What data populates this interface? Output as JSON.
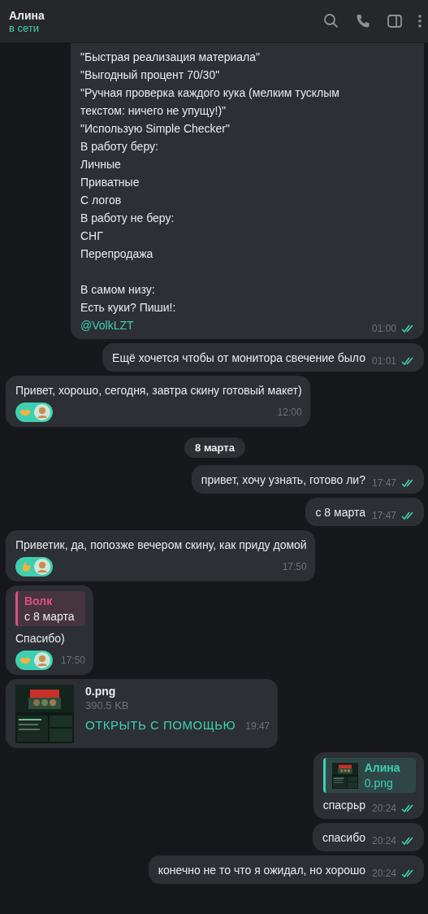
{
  "header": {
    "name": "Алина",
    "status": "в сети"
  },
  "messages": [
    {
      "kind": "text",
      "outgoing": true,
      "continued": true,
      "blocks": [
        [
          "\"Быстрая реализация материала\"",
          "\"Выгодный процент 70/30\"",
          "\"Ручная проверка каждого кука (мелким тусклым текстом: ничего не упущу!)\"",
          "\"Использую Simple Checker\"",
          "В работу беру:",
          "Личные",
          "Приватные",
          "С логов",
          "В работу не беру:",
          "СНГ",
          "Перепродажа"
        ],
        [
          "В самом низу:",
          "Есть куки? Пиши!:"
        ]
      ],
      "link": "@VolkLZT",
      "time": "01:00",
      "read": true
    },
    {
      "kind": "text",
      "outgoing": true,
      "blocks": [
        [
          "Ещё хочется чтобы от монитора свечение было"
        ]
      ],
      "time": "01:01",
      "read": true
    },
    {
      "kind": "text",
      "outgoing": false,
      "blocks": [
        [
          "Привет, хорошо, сегодня, завтра скину готовый макет)"
        ]
      ],
      "reactions": [
        {
          "kind": "handshake"
        },
        {
          "kind": "avatar"
        }
      ],
      "time": "12:00"
    },
    {
      "kind": "date",
      "text": "8 марта"
    },
    {
      "kind": "text",
      "outgoing": true,
      "blocks": [
        [
          "привет, хочу узнать, готово ли?"
        ]
      ],
      "time": "17:47",
      "read": true
    },
    {
      "kind": "text",
      "outgoing": true,
      "blocks": [
        [
          "с 8 марта"
        ]
      ],
      "time": "17:47",
      "read": true
    },
    {
      "kind": "text",
      "outgoing": false,
      "blocks": [
        [
          "Приветик, да, попозже вечером скину, как приду домой"
        ]
      ],
      "reactions": [
        {
          "kind": "thumbs-up"
        },
        {
          "kind": "avatar"
        }
      ],
      "time": "17:50"
    },
    {
      "kind": "reply",
      "outgoing": false,
      "quote": {
        "author": "Волк",
        "text": "с 8 марта",
        "color": "#e0507f"
      },
      "blocks": [
        [
          "Спасибо)"
        ]
      ],
      "reactions": [
        {
          "kind": "handshake"
        },
        {
          "kind": "avatar"
        }
      ],
      "time": "17:50"
    },
    {
      "kind": "file",
      "outgoing": false,
      "name": "0.png",
      "size": "390.5 KB",
      "action": "ОТКРЫТЬ С ПОМОЩЬЮ",
      "time": "19:47"
    },
    {
      "kind": "reply",
      "outgoing": true,
      "quote": {
        "author": "Алина",
        "text": "0.png",
        "color": "#3fd0b0",
        "thumb": true
      },
      "blocks": [
        [
          "спасрьр"
        ]
      ],
      "time": "20:24",
      "read": true
    },
    {
      "kind": "text",
      "outgoing": true,
      "blocks": [
        [
          "спасибо"
        ]
      ],
      "time": "20:24",
      "read": true
    },
    {
      "kind": "text",
      "outgoing": true,
      "blocks": [
        [
          "конечно не то что я ожидал, но хорошо"
        ]
      ],
      "time": "20:24",
      "read": true
    }
  ]
}
